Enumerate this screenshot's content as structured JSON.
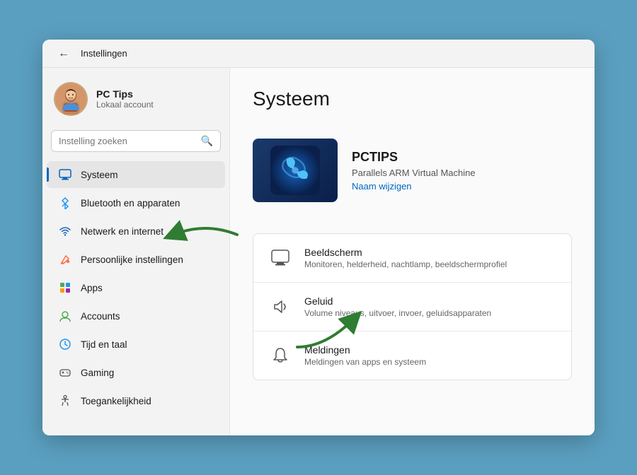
{
  "titlebar": {
    "title": "Instellingen",
    "back_label": "←"
  },
  "user": {
    "name": "PC Tips",
    "subtitle": "Lokaal account"
  },
  "search": {
    "placeholder": "Instelling zoeken"
  },
  "nav": {
    "items": [
      {
        "id": "systeem",
        "label": "Systeem",
        "icon": "monitor",
        "active": true
      },
      {
        "id": "bluetooth",
        "label": "Bluetooth en apparaten",
        "icon": "bluetooth"
      },
      {
        "id": "netwerk",
        "label": "Netwerk en internet",
        "icon": "wifi"
      },
      {
        "id": "persoonlijk",
        "label": "Persoonlijke instellingen",
        "icon": "paint"
      },
      {
        "id": "apps",
        "label": "Apps",
        "icon": "apps"
      },
      {
        "id": "accounts",
        "label": "Accounts",
        "icon": "user"
      },
      {
        "id": "tijd",
        "label": "Tijd en taal",
        "icon": "clock"
      },
      {
        "id": "gaming",
        "label": "Gaming",
        "icon": "game"
      },
      {
        "id": "toegankelijkheid",
        "label": "Toegankelijkheid",
        "icon": "accessibility"
      }
    ]
  },
  "main": {
    "title": "Systeem",
    "device": {
      "name": "PCTIPS",
      "description": "Parallels ARM Virtual Machine",
      "link_label": "Naam wijzigen"
    },
    "settings_items": [
      {
        "id": "beeldscherm",
        "title": "Beeldscherm",
        "description": "Monitoren, helderheid, nachtlamp, beeldschermprofiel"
      },
      {
        "id": "geluid",
        "title": "Geluid",
        "description": "Volume niveaus, uitvoer, invoer, geluidsapparaten"
      },
      {
        "id": "meldingen",
        "title": "Meldingen",
        "description": "Meldingen van apps en systeem"
      }
    ]
  }
}
